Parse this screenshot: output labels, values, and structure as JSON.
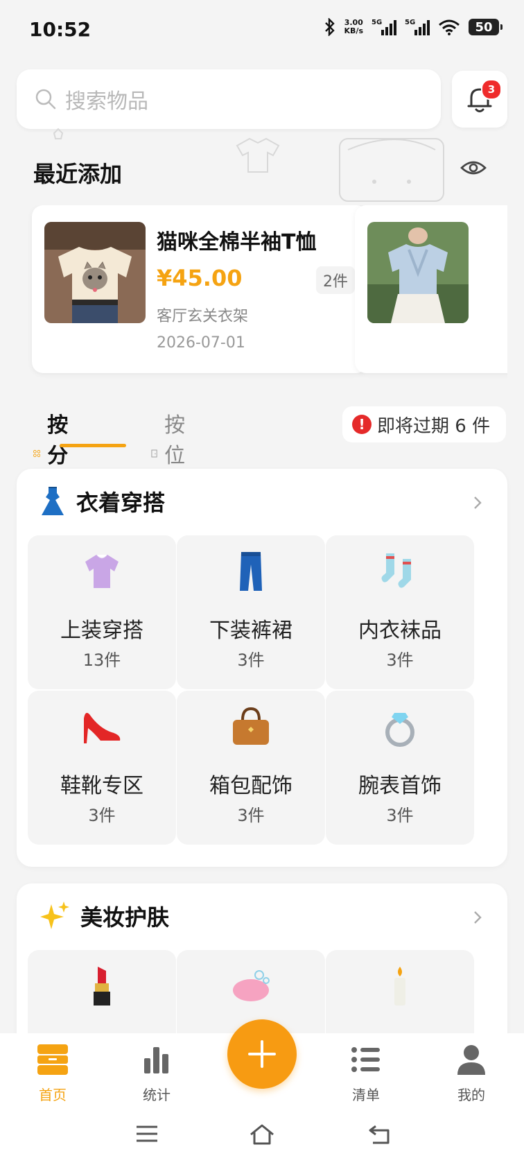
{
  "status": {
    "time": "10:52",
    "net_speed_value": "3.00",
    "net_speed_unit": "KB/s",
    "signal1_label": "5G",
    "signal2_label": "5G",
    "battery": "50"
  },
  "search": {
    "placeholder": "搜索物品"
  },
  "notifications": {
    "badge": "3"
  },
  "recent": {
    "title": "最近添加",
    "items": [
      {
        "name": "猫咪全棉半袖T恤",
        "price": "¥45.00",
        "qty": "2件",
        "location": "客厅玄关衣架",
        "date": "2026-07-01"
      },
      {
        "name": "",
        "price": "",
        "qty": "",
        "location": "",
        "date": ""
      }
    ]
  },
  "tabs": {
    "by_category": "按分类",
    "by_location": "按位置",
    "expiring": "即将过期 6 件"
  },
  "categories": [
    {
      "title": "衣着穿搭",
      "icon": "dress-icon",
      "items": [
        {
          "label": "上装穿搭",
          "count": "13件",
          "icon": "blouse-icon"
        },
        {
          "label": "下装裤裙",
          "count": "3件",
          "icon": "jeans-icon"
        },
        {
          "label": "内衣袜品",
          "count": "3件",
          "icon": "socks-icon"
        },
        {
          "label": "鞋靴专区",
          "count": "3件",
          "icon": "high-heel-icon"
        },
        {
          "label": "箱包配饰",
          "count": "3件",
          "icon": "handbag-icon"
        },
        {
          "label": "腕表首饰",
          "count": "3件",
          "icon": "ring-icon"
        }
      ]
    },
    {
      "title": "美妆护肤",
      "icon": "sparkles-icon",
      "items": [
        {
          "label": "",
          "count": "",
          "icon": "lipstick-icon"
        },
        {
          "label": "",
          "count": "",
          "icon": "soap-icon"
        },
        {
          "label": "",
          "count": "",
          "icon": "candle-icon"
        }
      ]
    }
  ],
  "nav": {
    "home": "首页",
    "stats": "统计",
    "list": "清单",
    "me": "我的"
  },
  "colors": {
    "accent": "#f5a312",
    "badge": "#ef2b2b",
    "background": "#f4f4f4"
  }
}
